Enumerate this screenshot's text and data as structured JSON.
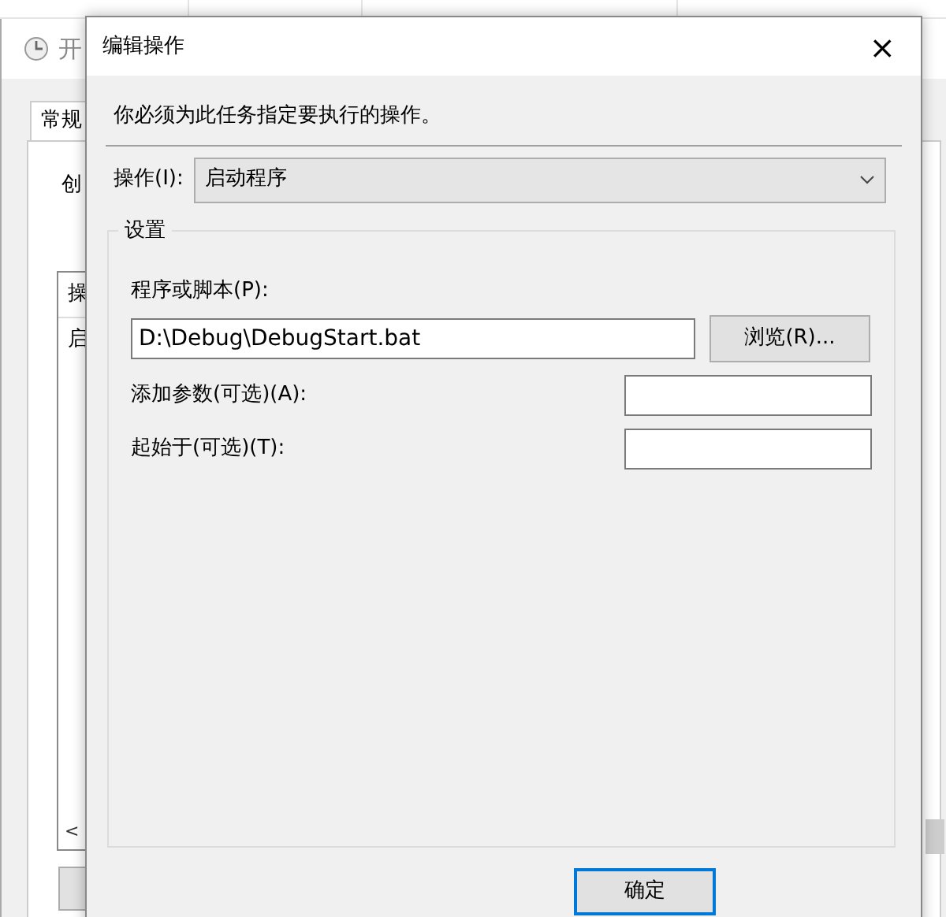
{
  "background_window": {
    "title": "开",
    "tabs": [
      {
        "label": "常规",
        "selected": true
      }
    ],
    "label": "创",
    "list_header": "操",
    "list_row": "启",
    "scroll_left": "<"
  },
  "dialog": {
    "title": "编辑操作",
    "close": "×",
    "instruction": "你必须为此任务指定要执行的操作。",
    "action_label": "操作(I):",
    "action_value": "启动程序",
    "group_title": "设置",
    "program_label": "程序或脚本(P):",
    "program_value": "D:\\Debug\\DebugStart.bat",
    "browse": "浏览(R)...",
    "args_label": "添加参数(可选)(A):",
    "start_label": "起始于(可选)(T):",
    "ok": "确定"
  }
}
